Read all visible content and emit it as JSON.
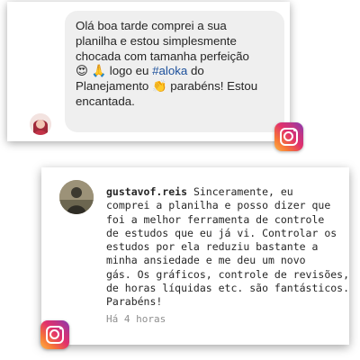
{
  "message_card": {
    "lines": [
      "Olá boa tarde comprei a sua",
      "planilha e estou simplesmente",
      "chocada com tamanha perfeição",
      [
        "😍 🙏 logo eu ",
        "#aloka",
        " do"
      ],
      [
        "Planejamento ",
        "👏",
        " parabéns! Estou"
      ],
      "encantada."
    ],
    "emoji_icons": [
      "heart-eyes-emoji",
      "praying-hands-emoji",
      "clapping-hands-emoji"
    ],
    "hashtag_color": "#1b4f9b",
    "bubble_color": "#efefef"
  },
  "comment_card": {
    "username": "gustavof.reis",
    "lines": [
      " Sinceramente, eu",
      "comprei a planilha e posso dizer que",
      "foi a melhor ferramenta de controle",
      "de estudos que eu já vi. Controlar os",
      "estudos por ela reduziu bastante a",
      "minha ansiedade e me deu um novo",
      "gás. Os gráficos, controle de revisões,",
      "de horas líquidas etc. são fantásticos.",
      "Parabéns!"
    ],
    "timestamp": "Há 4 horas"
  },
  "icons": [
    "instagram-logo-icon",
    "avatar"
  ],
  "colors": {
    "text": "#262626",
    "muted": "#8e8e8e",
    "instagram_gradient": [
      "#fdb548",
      "#f77737",
      "#e1306c",
      "#c13584",
      "#833ab4"
    ]
  }
}
